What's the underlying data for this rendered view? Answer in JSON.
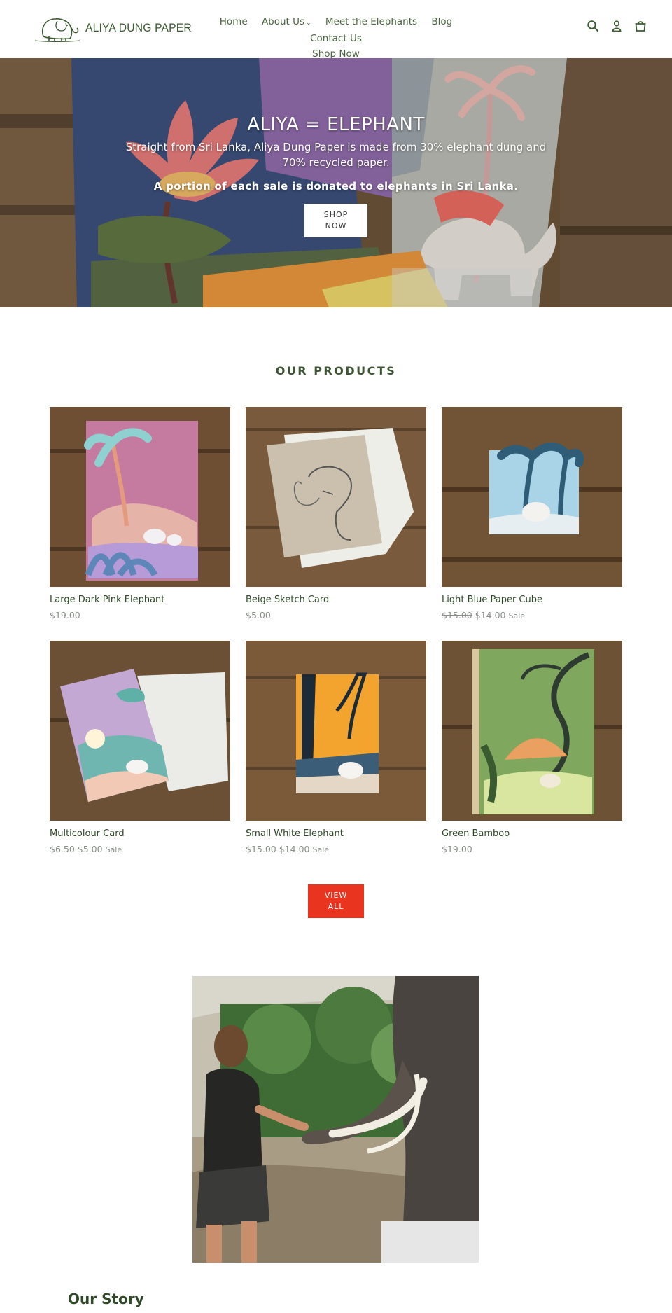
{
  "header": {
    "logo_text": "ALIYA DUNG PAPER",
    "nav": [
      {
        "label": "Home"
      },
      {
        "label": "About Us"
      },
      {
        "label": "Meet the Elephants"
      },
      {
        "label": "Blog"
      },
      {
        "label": "Contact Us"
      },
      {
        "label": "Shop Now"
      }
    ],
    "icons": [
      "search-icon",
      "account-icon",
      "cart-icon"
    ]
  },
  "hero": {
    "title": "ALIYA = ELEPHANT",
    "subtitle": "Straight from Sri Lanka, Aliya Dung Paper is made from 30% elephant dung and 70% recycled paper.",
    "bold_line": "A portion of each sale is donated to elephants in Sri Lanka.",
    "button_line1": "SHOP",
    "button_line2": "NOW"
  },
  "products": {
    "title": "OUR PRODUCTS",
    "items": [
      {
        "name": "Large Dark Pink Elephant",
        "price": "$19.00",
        "old_price": "",
        "sale_label": ""
      },
      {
        "name": "Beige Sketch Card",
        "price": "$5.00",
        "old_price": "",
        "sale_label": ""
      },
      {
        "name": "Light Blue Paper Cube",
        "price": "$14.00",
        "old_price": "$15.00",
        "sale_label": "Sale"
      },
      {
        "name": "Multicolour Card",
        "price": "$5.00",
        "old_price": "$6.50",
        "sale_label": "Sale"
      },
      {
        "name": "Small White Elephant",
        "price": "$14.00",
        "old_price": "$15.00",
        "sale_label": "Sale"
      },
      {
        "name": "Green Bamboo",
        "price": "$19.00",
        "old_price": "",
        "sale_label": ""
      }
    ],
    "view_all_line1": "VIEW",
    "view_all_line2": "ALL"
  },
  "story": {
    "title": "Our Story"
  },
  "colors": {
    "brand_green": "#3d5535",
    "accent_red": "#e93520",
    "muted_price": "#8a8f8a"
  }
}
